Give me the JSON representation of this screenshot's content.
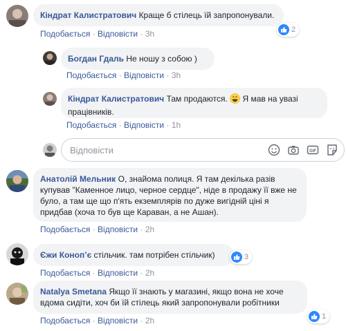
{
  "comments": [
    {
      "name": "Кіндрат Калистратович",
      "text": "Краще б стілець їй запропонували.",
      "like_label": "Подобається",
      "reply_label": "Відповісти",
      "time": "3h",
      "reactions": "2"
    },
    {
      "name": "Богдан Гдаль",
      "text": "Не ношу з собою )",
      "like_label": "Подобається",
      "reply_label": "Відповісти",
      "time": "3h"
    },
    {
      "name": "Кіндрат Калистратович",
      "text_line1": "Там продаются.",
      "text_line1_b": "Я мав на увазі",
      "text_line2": "працівників.",
      "like_label": "Подобається",
      "reply_label": "Відповісти",
      "time": "1h"
    },
    {
      "name": "Анатолій Мельник",
      "line1_rest": "О, знайома полиця. Я там декілька разів",
      "line2": "купував \"Каменное лицо, черное сердце\", ніде в продажу її вже не",
      "line3": "було, а там ще що п'ять екземплярів по дуже вигідній ціні я",
      "line4": "придбав (хоча то був ще Караван, а не Ашан).",
      "like_label": "Подобається",
      "reply_label": "Відповісти",
      "time": "2h"
    },
    {
      "name": "Єжи Конопʼє",
      "text": "стільчик. там потрібен стільчик)",
      "like_label": "Подобається",
      "reply_label": "Відповісти",
      "time": "2h",
      "reactions": "3"
    },
    {
      "name": "Natalya Smetana",
      "line1_rest": "Якщо її знають у магазині, якщо вона не хоче",
      "line2": "вдома сидіти, хоч би їй стілець який запропонували робітники",
      "like_label": "Подобається",
      "reply_label": "Відповісти",
      "time": "2h",
      "reactions": "1"
    }
  ],
  "reply_input": {
    "placeholder": "Відповісти"
  },
  "separator": "·",
  "colors": {
    "link": "#385898",
    "bubble": "#f2f3f5",
    "like": "#2d88ff",
    "meta": "#90949c"
  },
  "icons": [
    "like-icon",
    "emoji-icon",
    "camera-icon",
    "gif-icon",
    "sticker-icon",
    "laughing-emoji-icon"
  ]
}
